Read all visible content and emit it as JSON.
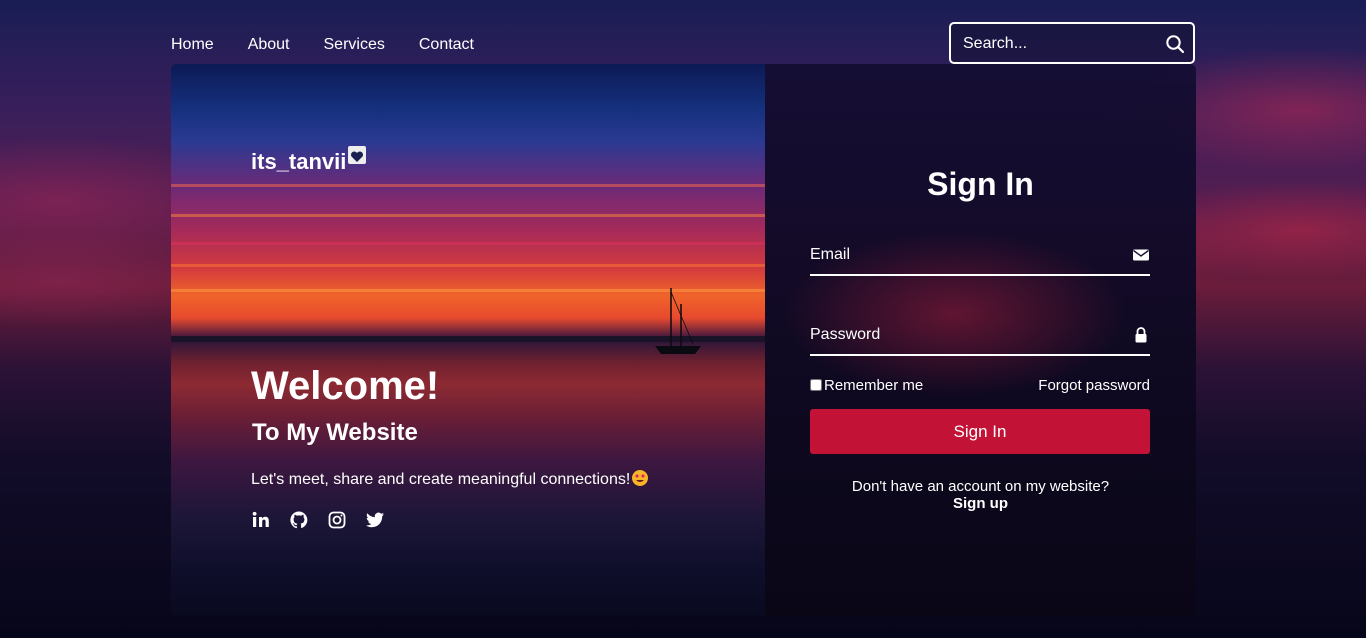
{
  "nav": {
    "links": [
      "Home",
      "About",
      "Services",
      "Contact"
    ],
    "search_placeholder": "Search..."
  },
  "hero": {
    "brand": "its_tanvii",
    "welcome": "Welcome!",
    "subtitle": "To My Website",
    "tagline": "Let's meet, share and create meaningful connections!",
    "socials": [
      "linkedin-icon",
      "github-icon",
      "instagram-icon",
      "twitter-icon"
    ]
  },
  "signin": {
    "title": "Sign In",
    "email_label": "Email",
    "password_label": "Password",
    "remember_label": "Remember me",
    "forgot_label": "Forgot password",
    "button_label": "Sign In",
    "no_account_text": "Don't have an account on my website?",
    "signup_label": "Sign up"
  },
  "colors": {
    "accent": "#c21236",
    "text": "#ffffff"
  }
}
